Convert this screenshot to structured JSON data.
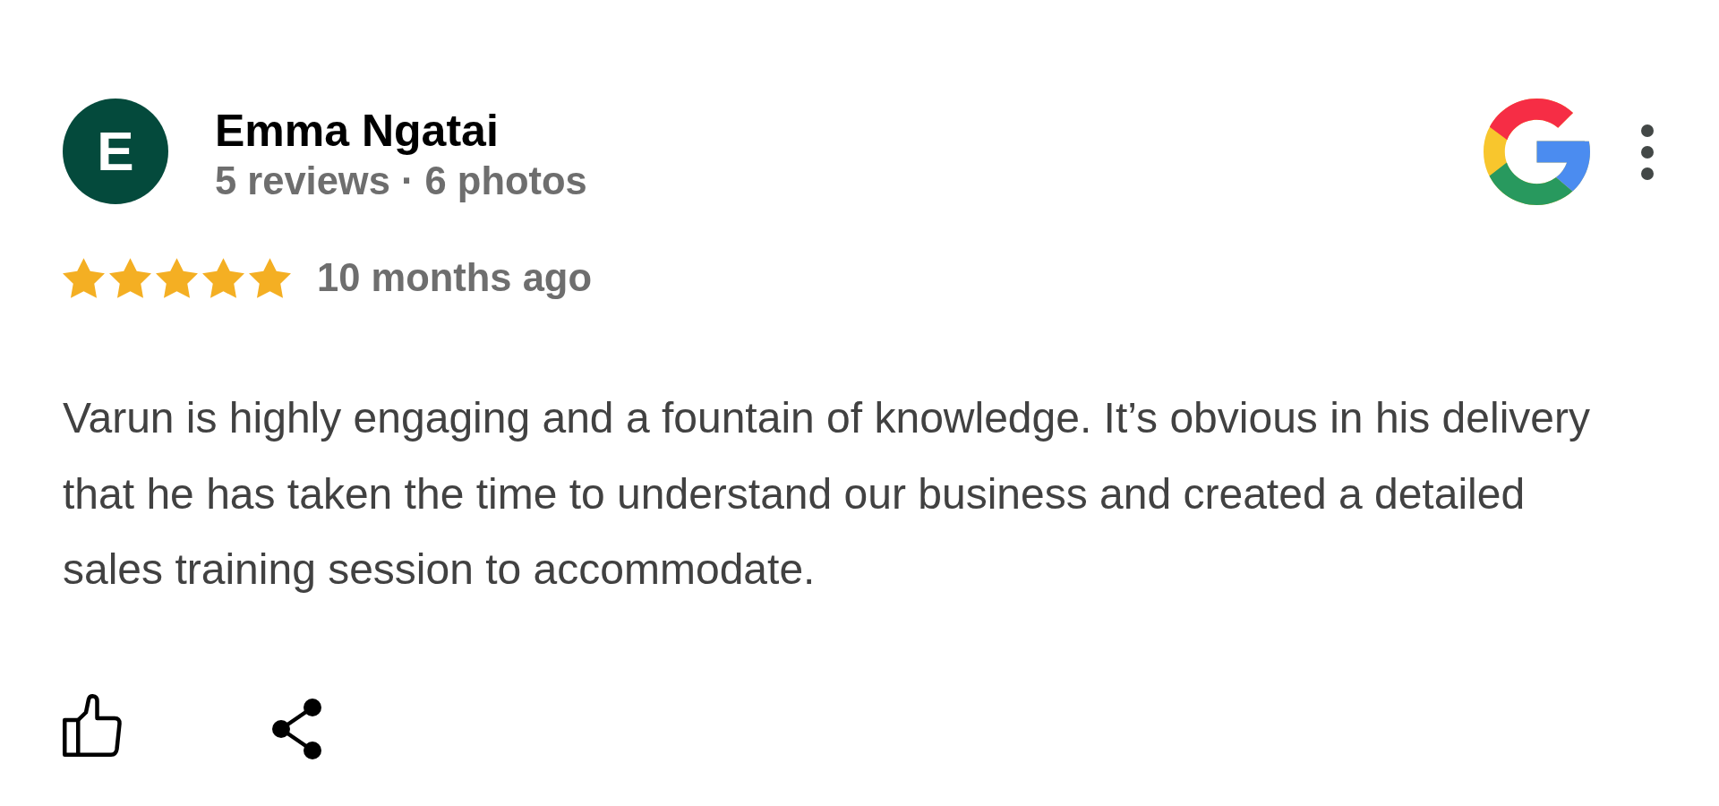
{
  "review": {
    "avatar_initial": "E",
    "author": "Emma Ngatai",
    "author_stats": "5 reviews · 6 photos",
    "stars": 5,
    "time": "10 months ago",
    "text": "Varun is highly engaging and a fountain of knowledge. It’s obvious in his delivery that he has taken the time to understand our business and created a detailed sales training session to accommodate."
  }
}
